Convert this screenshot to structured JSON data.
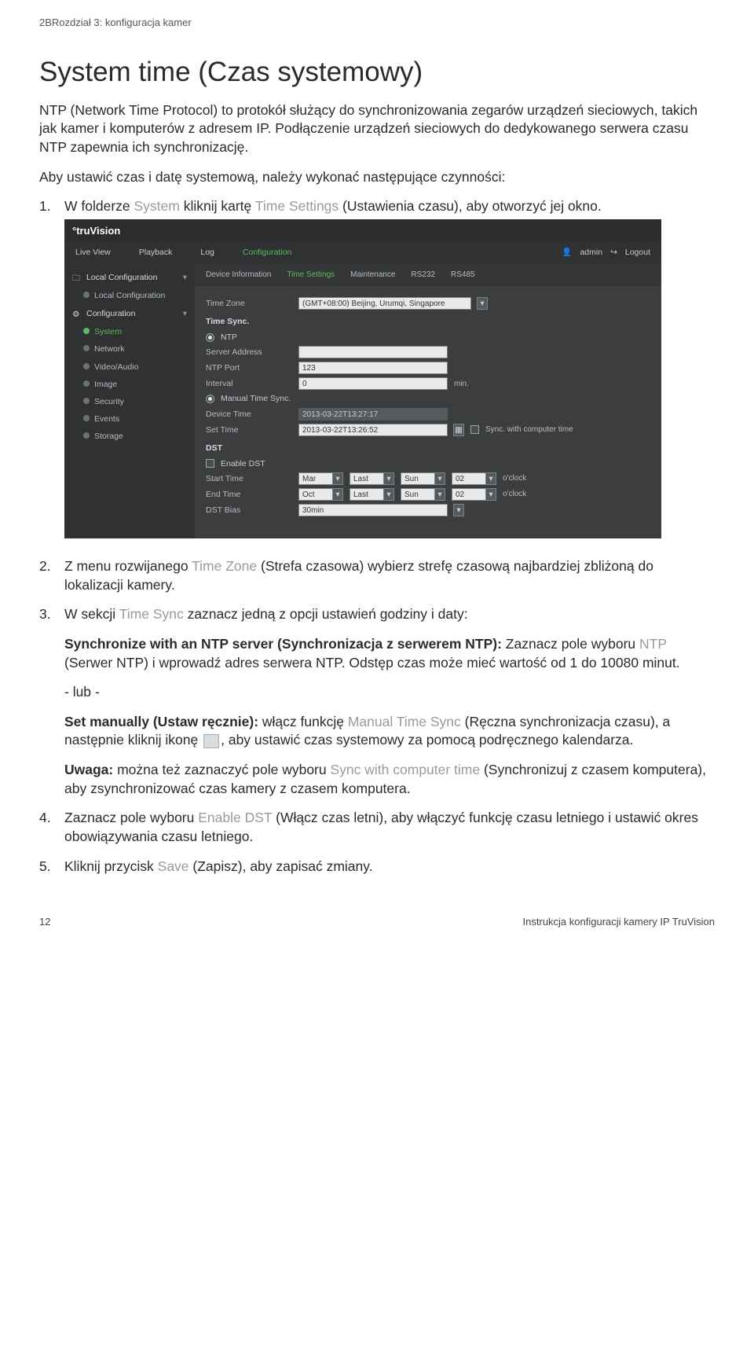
{
  "chapter_header": "2BRozdział 3: konfiguracja kamer",
  "title": "System time (Czas systemowy)",
  "intro1": "NTP (Network Time Protocol) to protokół służący do synchronizowania zegarów urządzeń sieciowych, takich jak kamer i komputerów z adresem IP. Podłączenie urządzeń sieciowych do dedykowanego serwera czasu NTP zapewnia ich synchronizację.",
  "intro2": "Aby ustawić czas i datę systemową, należy wykonać następujące czynności:",
  "steps": {
    "s1_a": "W folderze ",
    "s1_b": "System",
    "s1_c": " kliknij kartę ",
    "s1_d": "Time Settings",
    "s1_e": " (Ustawienia czasu), aby otworzyć jej okno.",
    "s2_a": "Z menu rozwijanego ",
    "s2_b": "Time Zone",
    "s2_c": " (Strefa czasowa) wybierz strefę czasową najbardziej zbliżoną do lokalizacji kamery.",
    "s3_a": "W sekcji ",
    "s3_b": "Time Sync",
    "s3_c": " zaznacz jedną z opcji ustawień godziny i daty:",
    "s3_ntp_a": "Synchronize with an NTP server (Synchronizacja z serwerem NTP):",
    "s3_ntp_b": " Zaznacz pole wyboru ",
    "s3_ntp_c": "NTP",
    "s3_ntp_d": " (Serwer NTP) i wprowadź adres serwera NTP. Odstęp czas może mieć wartość od 1 do 10080 minut.",
    "s3_or": "- lub -",
    "s3_man_a": "Set manually (Ustaw ręcznie):",
    "s3_man_b": " włącz funkcję ",
    "s3_man_c": "Manual Time Sync",
    "s3_man_d": " (Ręczna synchronizacja czasu), a następnie kliknij ikonę ",
    "s3_man_e": ", aby ustawić czas systemowy za pomocą podręcznego kalendarza.",
    "s3_note_a": "Uwaga:",
    "s3_note_b": " można też zaznaczyć pole wyboru ",
    "s3_note_c": "Sync with computer time",
    "s3_note_d": " (Synchronizuj z czasem komputera), aby zsynchronizować czas kamery z czasem komputera.",
    "s4_a": "Zaznacz pole wyboru ",
    "s4_b": "Enable DST",
    "s4_c": " (Włącz czas letni), aby włączyć funkcję czasu letniego i ustawić okres obowiązywania czasu letniego.",
    "s5_a": "Kliknij przycisk ",
    "s5_b": "Save",
    "s5_c": " (Zapisz), aby zapisać zmiany."
  },
  "footer": {
    "page": "12",
    "doc": "Instrukcja konfiguracji kamery IP TruVision"
  },
  "shot": {
    "brand": "truVision",
    "nav": {
      "live": "Live View",
      "playback": "Playback",
      "log": "Log",
      "config": "Configuration",
      "user": "admin",
      "logout": "Logout"
    },
    "side": {
      "local_cfg_grp": "Local Configuration",
      "local_cfg_item": "Local Configuration",
      "config_grp": "Configuration",
      "items": {
        "system": "System",
        "network": "Network",
        "video": "Video/Audio",
        "image": "Image",
        "security": "Security",
        "events": "Events",
        "storage": "Storage"
      }
    },
    "subtabs": {
      "dev": "Device Information",
      "time": "Time Settings",
      "maint": "Maintenance",
      "rs232": "RS232",
      "rs485": "RS485"
    },
    "form": {
      "tz_label": "Time Zone",
      "tz_value": "(GMT+08:00) Beijing, Urumqi, Singapore",
      "timesync_hdr": "Time Sync.",
      "ntp_label": "NTP",
      "srv_label": "Server Address",
      "port_label": "NTP Port",
      "port_val": "123",
      "int_label": "Interval",
      "int_val": "0",
      "int_unit": "min.",
      "manual_label": "Manual Time Sync.",
      "devtime_label": "Device Time",
      "devtime_val": "2013-03-22T13:27:17",
      "settime_label": "Set Time",
      "settime_val": "2013-03-22T13:26:52",
      "sync_pc": "Sync. with computer time",
      "dst_hdr": "DST",
      "enable_dst": "Enable DST",
      "start_label": "Start Time",
      "end_label": "End Time",
      "start": {
        "mon": "Mar",
        "week": "Last",
        "day": "Sun",
        "hour": "02",
        "unit": "o'clock"
      },
      "end": {
        "mon": "Oct",
        "week": "Last",
        "day": "Sun",
        "hour": "02",
        "unit": "o'clock"
      },
      "bias_label": "DST Bias",
      "bias_val": "30min"
    }
  }
}
